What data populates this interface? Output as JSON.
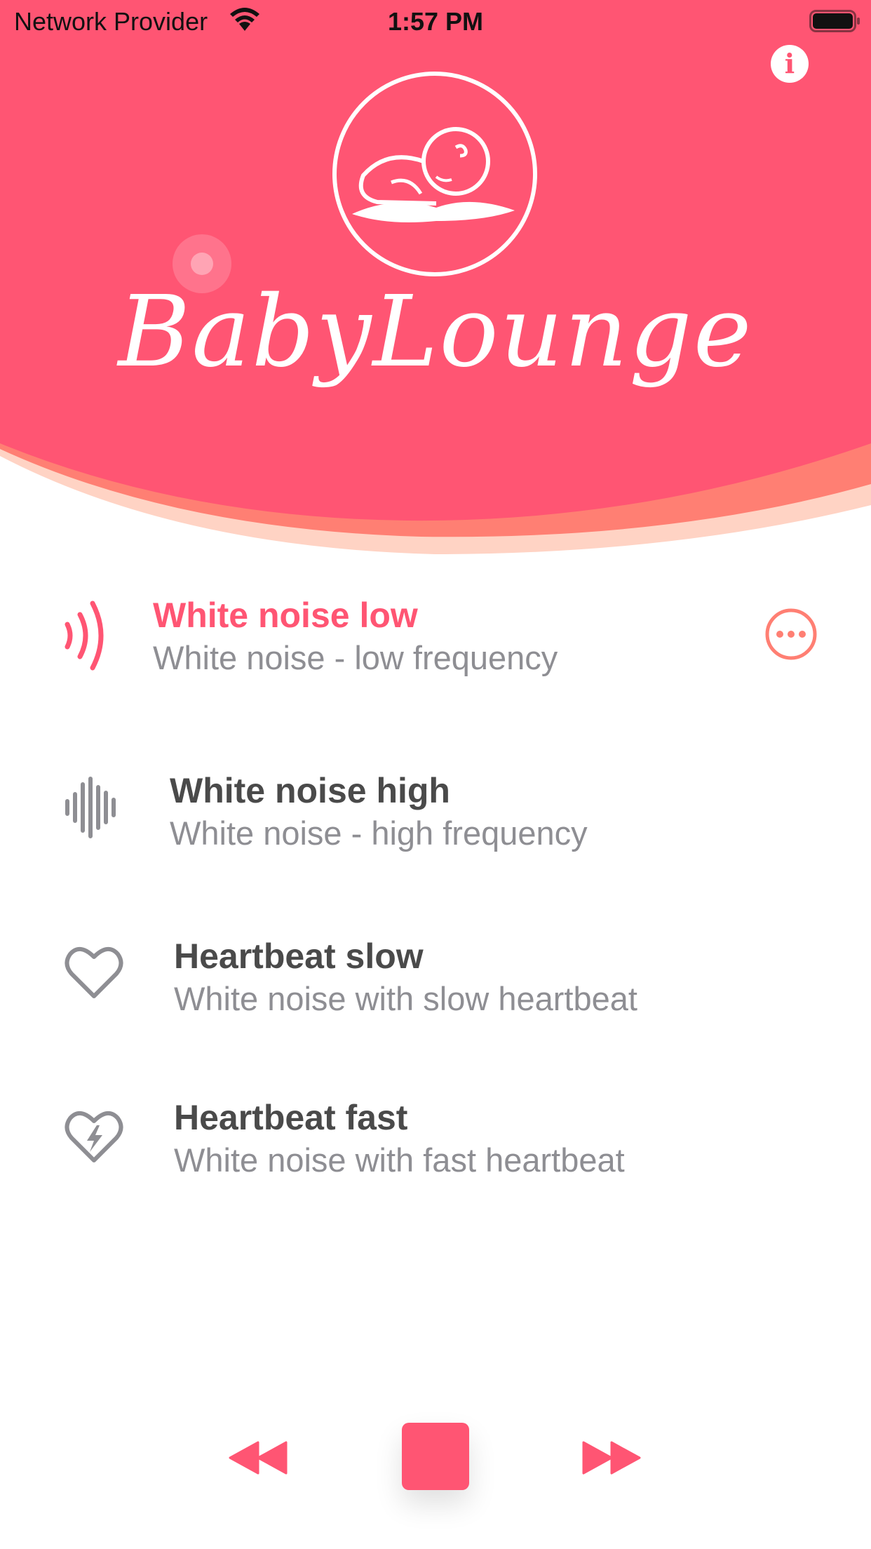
{
  "status_bar": {
    "carrier": "Network Provider",
    "time": "1:57 PM",
    "wifi_icon": "wifi-icon",
    "battery_icon": "battery-icon"
  },
  "header": {
    "brand": "BabyLounge",
    "info_icon_glyph": "i",
    "logo_icon": "sleeping-baby-icon",
    "colors": {
      "background": "#ff5573",
      "wave_mid": "#ff7f73",
      "wave_light": "#ffd3c4"
    }
  },
  "tracks": [
    {
      "title": "White noise low",
      "subtitle": "White noise - low frequency",
      "icon": "sound-waves-icon",
      "active": true
    },
    {
      "title": "White noise high",
      "subtitle": "White noise - high frequency",
      "icon": "waveform-icon",
      "active": false
    },
    {
      "title": "Heartbeat slow",
      "subtitle": "White noise with slow heartbeat",
      "icon": "heart-icon",
      "active": false
    },
    {
      "title": "Heartbeat fast",
      "subtitle": "White noise with fast heartbeat",
      "icon": "heart-bolt-icon",
      "active": false
    }
  ],
  "active_track_more_icon": "more-options-icon",
  "player": {
    "rewind_icon": "rewind-icon",
    "stop_icon": "stop-icon",
    "forward_icon": "fast-forward-icon"
  },
  "colors": {
    "accent": "#ff5573",
    "title_text": "#4a4a4a",
    "subtitle_text": "#8e8e93",
    "icon_gray": "#8e8e93"
  }
}
